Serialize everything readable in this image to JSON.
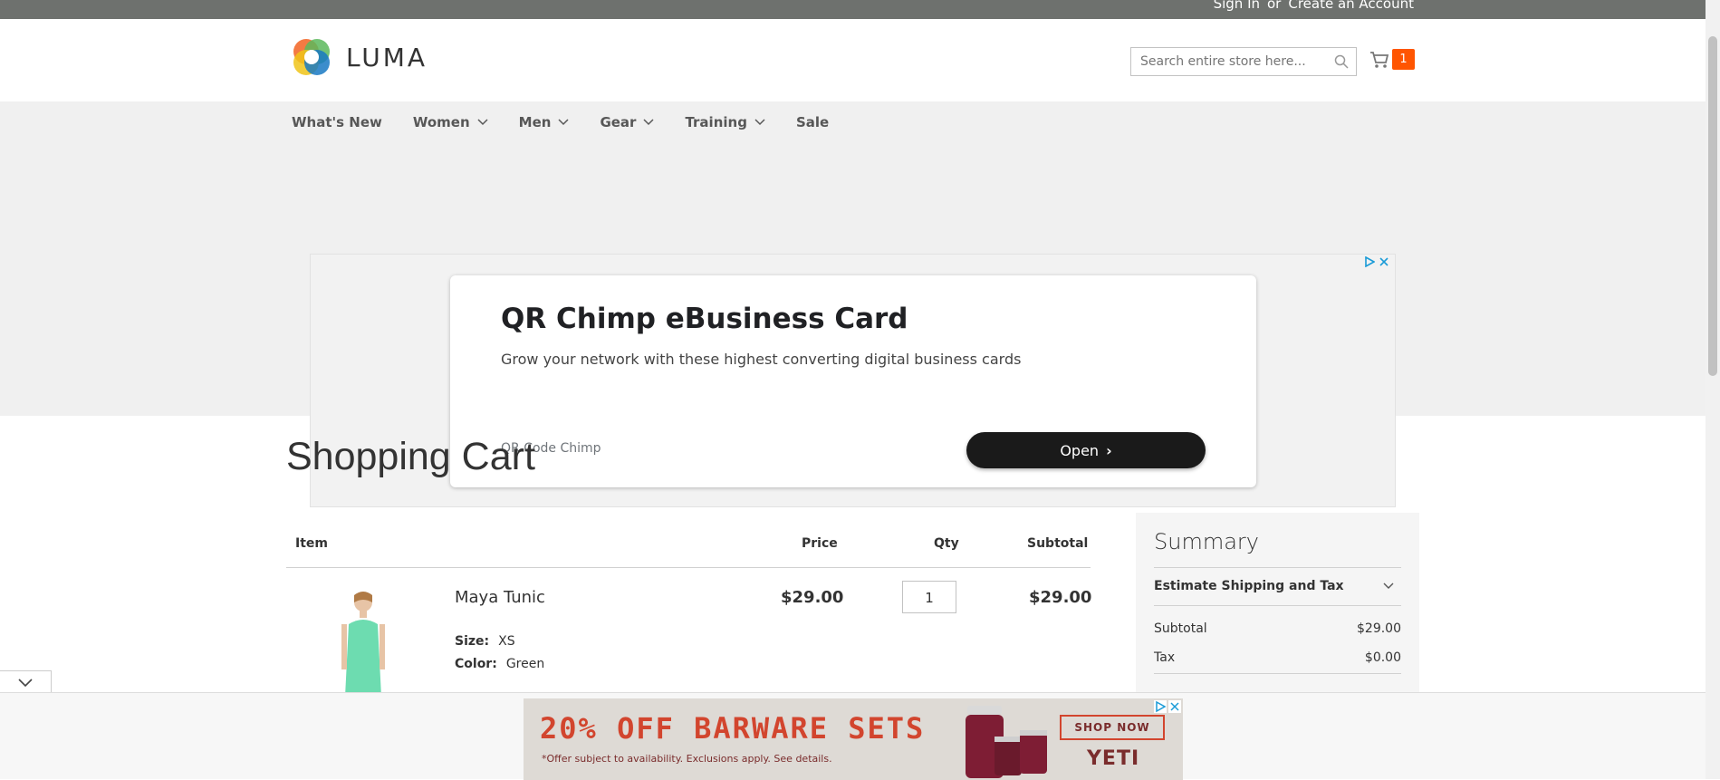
{
  "topbar": {
    "sign_in": "Sign In",
    "or": "or",
    "create_account": "Create an Account"
  },
  "logo": {
    "text": "LUMA"
  },
  "search": {
    "placeholder": "Search entire store here..."
  },
  "cart": {
    "count": "1"
  },
  "nav": {
    "items": [
      {
        "label": "What's New"
      },
      {
        "label": "Women"
      },
      {
        "label": "Men"
      },
      {
        "label": "Gear"
      },
      {
        "label": "Training"
      },
      {
        "label": "Sale"
      }
    ]
  },
  "ad_card": {
    "title": "QR Chimp eBusiness Card",
    "description": "Grow your network with these highest converting digital business cards",
    "brand": "QR Code Chimp",
    "button": "Open"
  },
  "page": {
    "title": "Shopping Cart"
  },
  "table": {
    "headers": {
      "item": "Item",
      "price": "Price",
      "qty": "Qty",
      "subtotal": "Subtotal"
    },
    "rows": [
      {
        "name": "Maya Tunic",
        "price": "$29.00",
        "qty": "1",
        "subtotal": "$29.00",
        "options": [
          {
            "label": "Size:",
            "value": "XS"
          },
          {
            "label": "Color:",
            "value": "Green"
          }
        ]
      }
    ]
  },
  "summary": {
    "title": "Summary",
    "estimate": "Estimate Shipping and Tax",
    "subtotal_label": "Subtotal",
    "subtotal_value": "$29.00",
    "tax_label": "Tax",
    "tax_value": "$0.00"
  },
  "banner": {
    "headline": "20% OFF BARWARE SETS",
    "fine_print": "*Offer subject to availability. Exclusions apply. See details.",
    "cta": "SHOP NOW",
    "brand": "YETI"
  },
  "colors": {
    "topbar": "#6e716e",
    "cart_badge": "#ff5501",
    "banner_red": "#d2452e"
  }
}
